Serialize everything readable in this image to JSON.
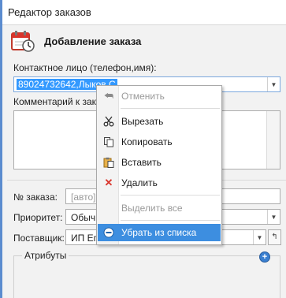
{
  "window": {
    "title": "Редактор заказов"
  },
  "header": {
    "title": "Добавление заказа",
    "icon": "calendar-icon"
  },
  "form": {
    "contact_label": "Контактное лицо (телефон,имя):",
    "contact_value": "89024732642,Лыков С",
    "comment_label": "Комментарий к заказу",
    "order_no_label": "№ заказа:",
    "order_no_placeholder": "[авто]",
    "priority_label": "Приоритет:",
    "priority_value": "Обычн",
    "supplier_label": "Поставщик:",
    "supplier_value": "ИП Егор",
    "attributes_label": "Атрибуты"
  },
  "context_menu": {
    "items": [
      {
        "label": "Отменить",
        "icon": "undo-icon",
        "disabled": true
      },
      {
        "label": "Вырезать",
        "icon": "cut-icon",
        "disabled": false
      },
      {
        "label": "Копировать",
        "icon": "copy-icon",
        "disabled": false
      },
      {
        "label": "Вставить",
        "icon": "paste-icon",
        "disabled": false
      },
      {
        "label": "Удалить",
        "icon": "delete-icon",
        "disabled": false
      },
      {
        "label": "Выделить все",
        "icon": "",
        "disabled": true
      },
      {
        "label": "Убрать из списка",
        "icon": "remove-icon",
        "disabled": false,
        "highlighted": true
      }
    ]
  },
  "colors": {
    "accent": "#3d8ee0",
    "selection": "#3399ff",
    "delete": "#d9342b"
  }
}
